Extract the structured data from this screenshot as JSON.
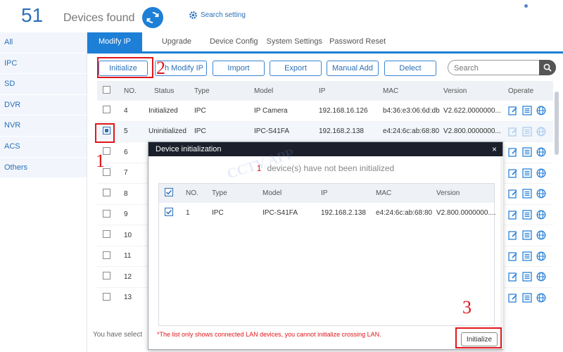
{
  "header": {
    "device_count": "51",
    "devices_found_label": "Devices found",
    "search_setting_label": "Search setting"
  },
  "sidebar": {
    "items": [
      {
        "label": "All"
      },
      {
        "label": "IPC"
      },
      {
        "label": "SD"
      },
      {
        "label": "DVR"
      },
      {
        "label": "NVR"
      },
      {
        "label": "ACS"
      },
      {
        "label": "Others"
      }
    ]
  },
  "tabs": [
    {
      "label": "Modify IP",
      "active": true
    },
    {
      "label": "Upgrade"
    },
    {
      "label": "Device Config"
    },
    {
      "label": "System Settings"
    },
    {
      "label": "Password Reset"
    }
  ],
  "toolbar": {
    "initialize_label": "Initialize",
    "batch_modify_label": "h Modify IP",
    "import_label": "Import",
    "export_label": "Export",
    "manual_add_label": "Manual Add",
    "delete_label": "Delect",
    "search_placeholder": "Search"
  },
  "table": {
    "columns": [
      "NO.",
      "Status",
      "Type",
      "Model",
      "IP",
      "MAC",
      "Version",
      "Operate"
    ],
    "rows": [
      {
        "no": "4",
        "status": "Initialized",
        "type": "IPC",
        "model": "IP Camera",
        "ip": "192.168.16.126",
        "mac": "b4:36:e3:06:6d:db",
        "version": "V2.622.0000000...",
        "checked": false
      },
      {
        "no": "5",
        "status": "Uninitialized",
        "type": "IPC",
        "model": "IPC-S41FA",
        "ip": "192.168.2.138",
        "mac": "e4:24:6c:ab:68:80",
        "version": "V2.800.0000000...",
        "checked": true
      },
      {
        "no": "6"
      },
      {
        "no": "7"
      },
      {
        "no": "8"
      },
      {
        "no": "9"
      },
      {
        "no": "10"
      },
      {
        "no": "11"
      },
      {
        "no": "12"
      },
      {
        "no": "13"
      }
    ]
  },
  "footer": {
    "text": "You have select"
  },
  "dialog": {
    "title": "Device initialization",
    "close": "×",
    "message_count": "1",
    "message": "device(s) have not been initialized",
    "watermark": "CCTV APP",
    "columns": [
      "NO.",
      "Type",
      "Model",
      "IP",
      "MAC",
      "Version"
    ],
    "rows": [
      {
        "no": "1",
        "type": "IPC",
        "model": "IPC-S41FA",
        "ip": "192.168.2.138",
        "mac": "e4:24:6c:ab:68:80",
        "version": "V2.800.0000000...."
      }
    ],
    "note": "*The list only shows connected LAN devices, you cannot initialize crossing LAN.",
    "initialize_label": "Initialize"
  },
  "annotations": {
    "step1": "1",
    "step2": "2",
    "step3": "3"
  },
  "colors": {
    "accent": "#1e7fd6",
    "annotation": "#e0171b",
    "dialog_title_bg": "#1a1f2b"
  }
}
